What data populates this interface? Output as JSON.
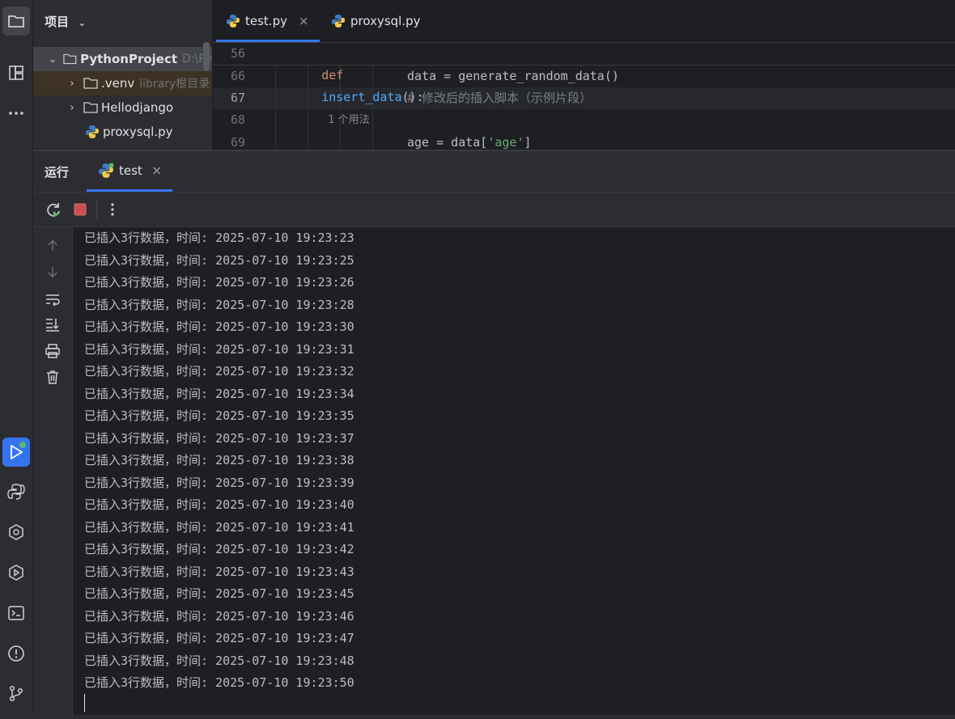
{
  "project_panel": {
    "title": "项目",
    "items": [
      {
        "label": "PythonProject",
        "hint": "D:\\Py"
      },
      {
        "label": ".venv",
        "hint": "library根目录"
      },
      {
        "label": "Hellodjango",
        "hint": ""
      },
      {
        "label": "proxysql.py",
        "hint": ""
      }
    ]
  },
  "editor": {
    "tabs": [
      {
        "label": "test.py",
        "active": true
      },
      {
        "label": "proxysql.py",
        "active": false
      }
    ],
    "lines": [
      {
        "num": "56",
        "keyword": "def",
        "func": "insert_data",
        "rest": "():",
        "hint": "1 个用法"
      },
      {
        "num": "66",
        "code": "data = generate_random_data()"
      },
      {
        "num": "67",
        "comment": "# 修改后的插入脚本（示例片段）"
      },
      {
        "num": "68",
        "code": ""
      },
      {
        "num": "69",
        "code_pre": "age = data[",
        "string": "'age'",
        "code_post": "]"
      }
    ]
  },
  "run": {
    "title": "运行",
    "tab_label": "test",
    "output": [
      "已插入3行数据，时间: 2025-07-10 19:23:23",
      "已插入3行数据，时间: 2025-07-10 19:23:25",
      "已插入3行数据，时间: 2025-07-10 19:23:26",
      "已插入3行数据，时间: 2025-07-10 19:23:28",
      "已插入3行数据，时间: 2025-07-10 19:23:30",
      "已插入3行数据，时间: 2025-07-10 19:23:31",
      "已插入3行数据，时间: 2025-07-10 19:23:32",
      "已插入3行数据，时间: 2025-07-10 19:23:34",
      "已插入3行数据，时间: 2025-07-10 19:23:35",
      "已插入3行数据，时间: 2025-07-10 19:23:37",
      "已插入3行数据，时间: 2025-07-10 19:23:38",
      "已插入3行数据，时间: 2025-07-10 19:23:39",
      "已插入3行数据，时间: 2025-07-10 19:23:40",
      "已插入3行数据，时间: 2025-07-10 19:23:41",
      "已插入3行数据，时间: 2025-07-10 19:23:42",
      "已插入3行数据，时间: 2025-07-10 19:23:43",
      "已插入3行数据，时间: 2025-07-10 19:23:45",
      "已插入3行数据，时间: 2025-07-10 19:23:46",
      "已插入3行数据，时间: 2025-07-10 19:23:47",
      "已插入3行数据，时间: 2025-07-10 19:23:48",
      "已插入3行数据，时间: 2025-07-10 19:23:50"
    ]
  },
  "colors": {
    "accent": "#3574f0",
    "keyword": "#cf8e6d",
    "function": "#56a8f5",
    "comment": "#7a7e85",
    "string": "#6aab73",
    "stop": "#c94f4f"
  }
}
